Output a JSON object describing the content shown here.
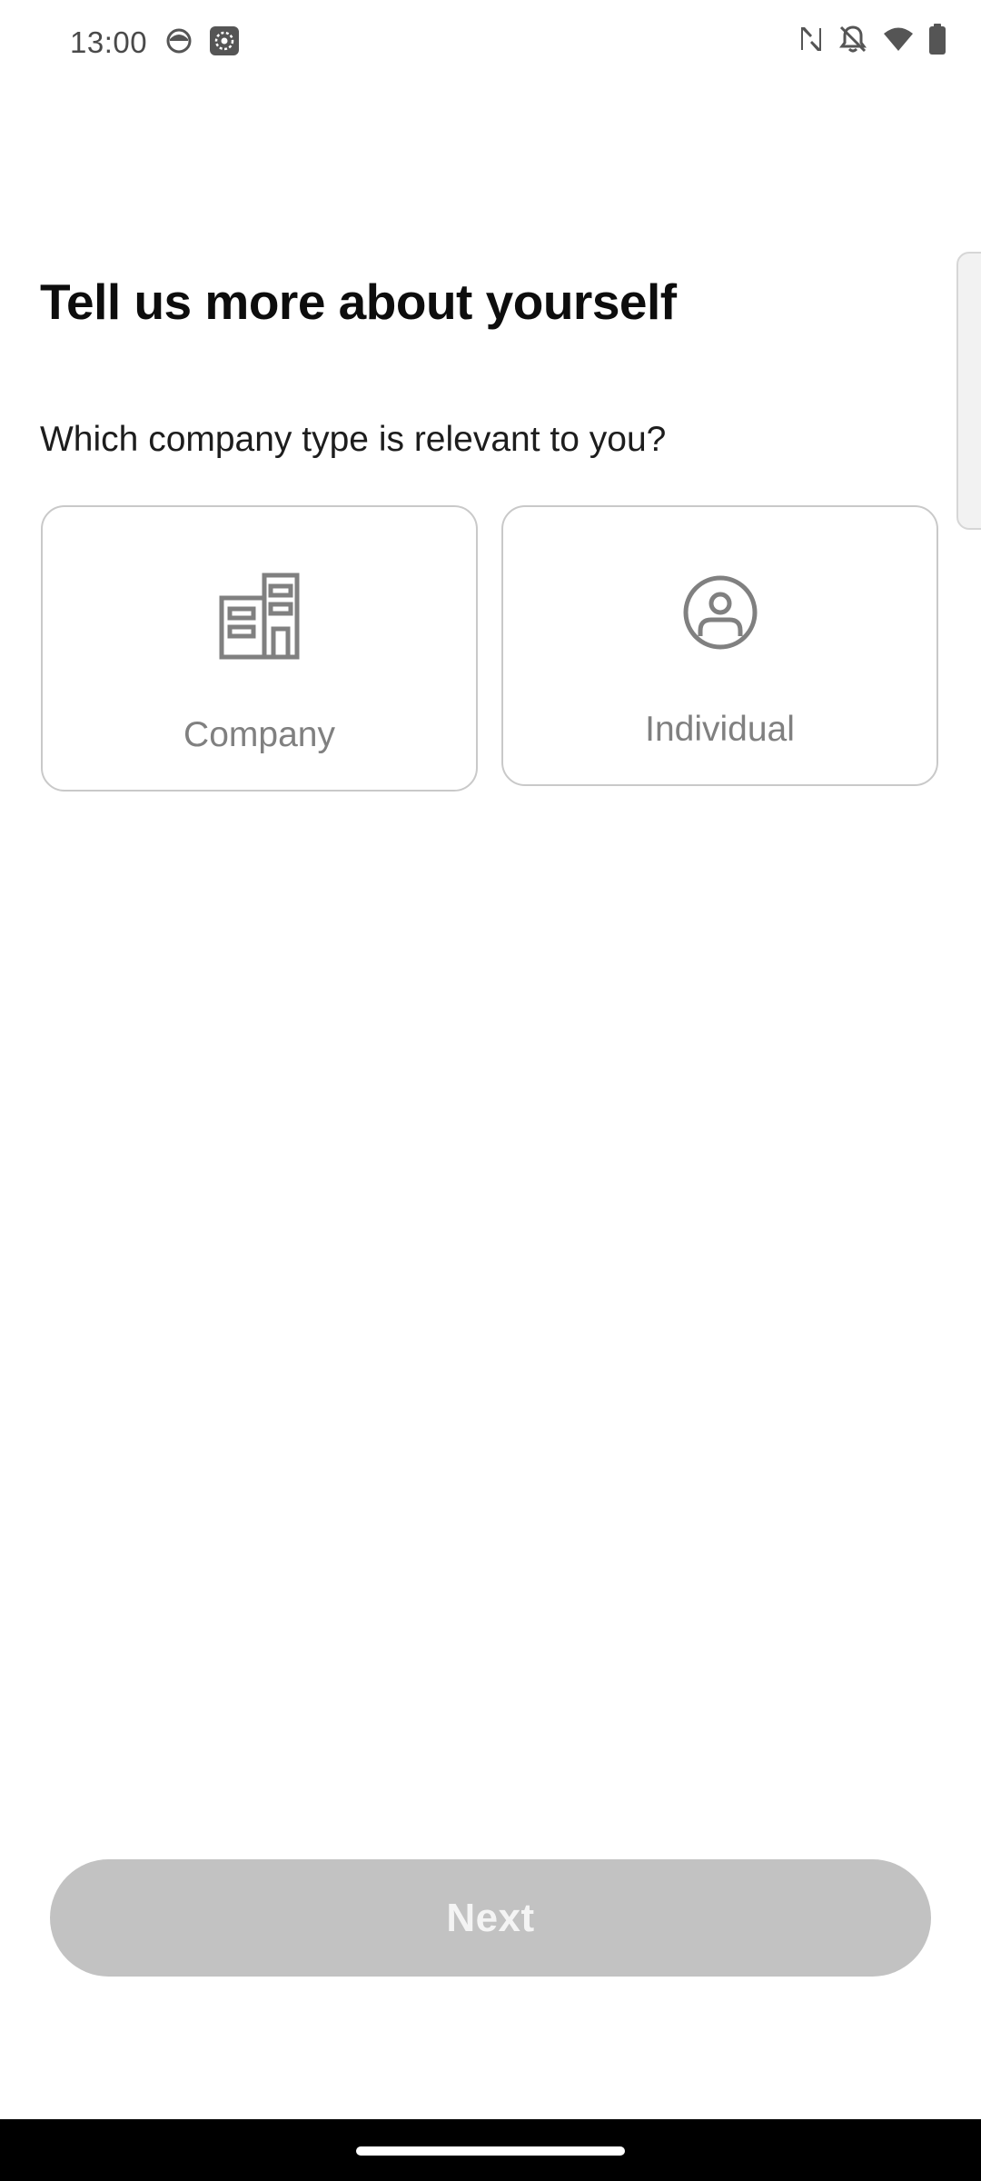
{
  "status_bar": {
    "time": "13:00",
    "left_icons": [
      "face-notification-icon",
      "settings-notification-icon"
    ],
    "right_icons": [
      "nfc-icon",
      "bell-off-icon",
      "wifi-icon",
      "battery-icon"
    ]
  },
  "header": {
    "title": "Tell us more about yourself"
  },
  "question": {
    "text": "Which company type is relevant to you?"
  },
  "options": [
    {
      "label": "Company",
      "icon": "building-icon"
    },
    {
      "label": "Individual",
      "icon": "user-circle-icon"
    }
  ],
  "footer": {
    "next_label": "Next",
    "next_enabled": false
  },
  "colors": {
    "button_disabled": "#c2c2c2",
    "card_border": "#c9c9c9",
    "icon_gray": "#808080"
  }
}
